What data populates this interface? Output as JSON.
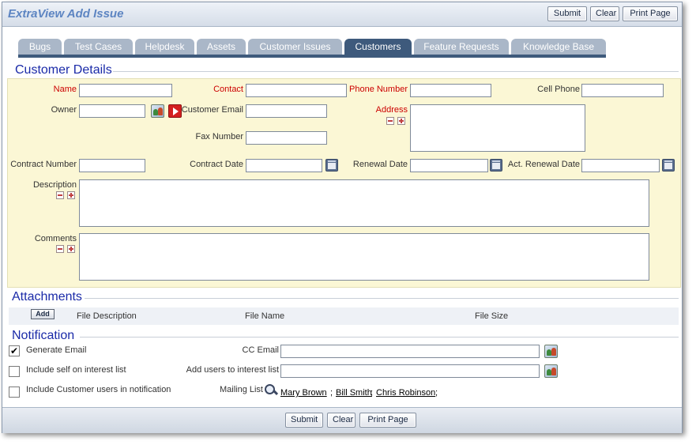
{
  "header": {
    "title": "ExtraView Add Issue",
    "submit_label": "Submit",
    "clear_label": "Clear",
    "print_label": "Print Page"
  },
  "tabs": [
    {
      "label": "Bugs",
      "active": false
    },
    {
      "label": "Test Cases",
      "active": false
    },
    {
      "label": "Helpdesk",
      "active": false
    },
    {
      "label": "Assets",
      "active": false
    },
    {
      "label": "Customer Issues",
      "active": false
    },
    {
      "label": "Customers",
      "active": true
    },
    {
      "label": "Feature Requests",
      "active": false
    },
    {
      "label": "Knowledge Base",
      "active": false
    }
  ],
  "customer_details": {
    "title": "Customer Details",
    "fields": {
      "name": {
        "label": "Name",
        "value": "",
        "required": true
      },
      "contact": {
        "label": "Contact",
        "value": "",
        "required": true
      },
      "phone_number": {
        "label": "Phone Number",
        "value": "",
        "required": true
      },
      "cell_phone": {
        "label": "Cell Phone",
        "value": ""
      },
      "owner": {
        "label": "Owner",
        "value": ""
      },
      "customer_email": {
        "label": "Customer Email",
        "value": ""
      },
      "address": {
        "label": "Address",
        "value": "",
        "required": true
      },
      "fax_number": {
        "label": "Fax Number",
        "value": ""
      },
      "contract_number": {
        "label": "Contract Number",
        "value": ""
      },
      "contract_date": {
        "label": "Contract Date",
        "value": ""
      },
      "renewal_date": {
        "label": "Renewal Date",
        "value": ""
      },
      "act_renewal_date": {
        "label": "Act. Renewal Date",
        "value": ""
      },
      "description": {
        "label": "Description",
        "value": ""
      },
      "comments": {
        "label": "Comments",
        "value": ""
      }
    }
  },
  "attachments": {
    "title": "Attachments",
    "add_label": "Add",
    "columns": [
      "File Description",
      "File Name",
      "File Size"
    ]
  },
  "notification": {
    "title": "Notification",
    "generate_email": {
      "label": "Generate Email",
      "checked": true
    },
    "include_self": {
      "label": "Include self on interest list",
      "checked": false
    },
    "include_customer_users": {
      "label": "Include Customer users in notification",
      "checked": false
    },
    "cc_email_label": "CC Email",
    "add_users_label": "Add users to interest list",
    "mailing_list_label": "Mailing List",
    "mailing_list": [
      "Mary Brown",
      "Bill Smith",
      "Chris Robinson"
    ],
    "separator": ";"
  },
  "footer": {
    "submit_label": "Submit",
    "clear_label": "Clear",
    "print_label": "Print Page"
  },
  "icons": {
    "user_picker": "user-picker-icon",
    "goto": "goto-arrow-icon",
    "calendar": "calendar-icon",
    "search": "search-icon",
    "collapse": "minus-icon",
    "expand": "plus-icon"
  },
  "colors": {
    "accent": "#3e5a7c",
    "tab_inactive": "#aab7c8",
    "section_title": "#1a2aa8",
    "required": "#cc0000",
    "panel_bg": "#fbf7d5"
  }
}
